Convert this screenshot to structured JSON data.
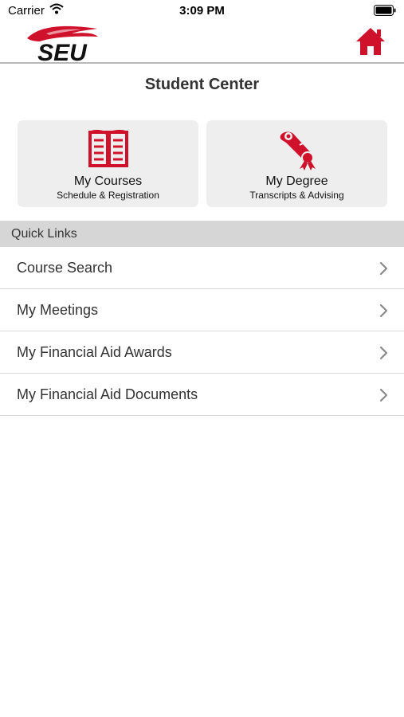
{
  "status": {
    "carrier": "Carrier",
    "time": "3:09 PM"
  },
  "header": {
    "logo_text": "SEU",
    "logo_icon": "seu-flame-logo",
    "home_icon": "home-icon"
  },
  "page": {
    "title": "Student Center"
  },
  "tiles": [
    {
      "title": "My Courses",
      "subtitle": "Schedule & Registration",
      "icon": "book-icon"
    },
    {
      "title": "My Degree",
      "subtitle": "Transcripts & Advising",
      "icon": "diploma-icon"
    }
  ],
  "quick_links": {
    "header": "Quick Links",
    "items": [
      {
        "label": "Course Search"
      },
      {
        "label": "My Meetings"
      },
      {
        "label": "My Financial Aid Awards"
      },
      {
        "label": "My Financial Aid Documents"
      }
    ]
  },
  "colors": {
    "accent": "#d0112b",
    "tile_bg": "#eeeeee",
    "section_bg": "#d6d6d6"
  }
}
